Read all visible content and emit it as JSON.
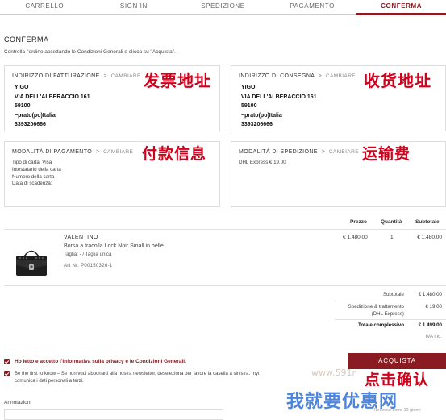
{
  "steps": [
    "CARRELLO",
    "SIGN IN",
    "SPEDIZIONE",
    "PAGAMENTO",
    "CONFERMA"
  ],
  "page": {
    "title": "CONFERMA",
    "intro": "Controlla l'ordine accettando le Condizioni Generali e clicca su \"Acquista\"."
  },
  "billing": {
    "heading": "INDIRIZZO DI FATTURAZIONE",
    "change": "CAMBIARE",
    "lines": [
      "YIGO",
      "VIA DELL'ALBERACCIO 161",
      "59100",
      "−prato(po)Italia",
      "3393206666"
    ],
    "annotation": "发票地址"
  },
  "shipping_address": {
    "heading": "INDIRIZZO DI CONSEGNA",
    "change": "CAMBIARE",
    "lines": [
      "YIGO",
      "VIA DELL'ALBERACCIO 161",
      "59100",
      "−prato(po)Italia",
      "3393206666"
    ],
    "annotation": "收货地址"
  },
  "payment": {
    "heading": "MODALITÀ DI PAGAMENTO",
    "change": "CAMBIARE",
    "lines": [
      "Tipo di carta: Visa",
      "Intestatario della carta",
      "Numero della carta",
      "Data di scadenza:"
    ],
    "annotation": "付款信息"
  },
  "shipping_method": {
    "heading": "MODALITÀ DI SPEDIZIONE",
    "change": "CAMBIARE",
    "line": "DHL Express € 19,00",
    "annotation": "运输费"
  },
  "table": {
    "headers": {
      "price": "Prezzo",
      "qty": "Quantità",
      "subtotal": "Subtotale"
    },
    "item": {
      "brand": "VALENTINO",
      "name": "Borsa a tracolla Lock Noir Small in pelle",
      "size": "Taglia: - / Taglia unica",
      "art": "Art Nr. P00150326-1",
      "price": "€ 1.480,00",
      "qty": "1",
      "subtotal": "€ 1.480,00"
    }
  },
  "summary": {
    "subtotal_label": "Subtotale",
    "subtotal_value": "€ 1.480,00",
    "shipping_label": "Spedizione & trattamento",
    "shipping_sub": "(DHL Express)",
    "shipping_value": "€ 19,00",
    "total_label": "Totale complessivo",
    "total_value": "€ 1.499,00",
    "vat": "IVA inc."
  },
  "consent": {
    "privacy_pre": "Ho letto e accetto l'informativa sulla",
    "privacy_link": "privacy",
    "mid": "e le",
    "terms_link": "Condizioni Generali",
    "newsletter_1": "Be the first to know – Se non vuoi abbonarti alla nostra newsletter, deseleziona per favore la casella a sinistra. myt",
    "newsletter_2": "comunica i dati personali a terzi."
  },
  "buy_button": "ACQUISTA",
  "buy_sub": "Recesso entro 10 giorni",
  "buy_annotation": "点击确认",
  "watermark_site": "www.591r",
  "watermark_cn": "我就要优惠网",
  "notes_label": "Annotazioni",
  "colors": {
    "brand": "#8a1b22",
    "annotation": "#d1001c",
    "watermark": "#2f6fd6"
  }
}
